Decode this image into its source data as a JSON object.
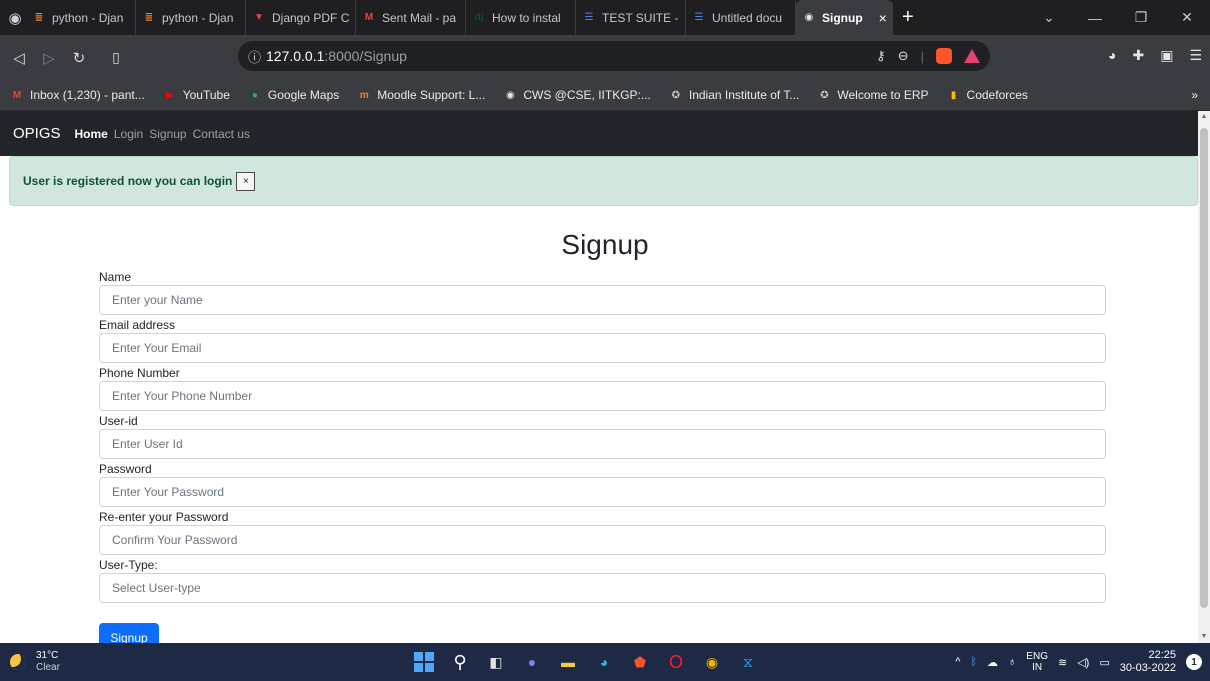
{
  "browser": {
    "tabs": [
      {
        "title": "python - Djan",
        "icon": "stackoverflow-icon",
        "icon_color": "#f48024"
      },
      {
        "title": "python - Djan",
        "icon": "stackoverflow-icon",
        "icon_color": "#f48024"
      },
      {
        "title": "Django PDF C",
        "icon": "vue-icon",
        "icon_color": "#e0424b"
      },
      {
        "title": "Sent Mail - pa",
        "icon": "gmail-icon",
        "icon_color": "#ea4335"
      },
      {
        "title": "How to instal",
        "icon": "django-icon",
        "icon_color": "#0c4b33"
      },
      {
        "title": "TEST SUITE -",
        "icon": "docs-icon",
        "icon_color": "#4285f4"
      },
      {
        "title": "Untitled docu",
        "icon": "docs-icon",
        "icon_color": "#4285f4"
      }
    ],
    "active_tab": {
      "title": "Signup",
      "close": "×"
    },
    "new_tab": "+",
    "url_host": "127.0.0.1",
    "url_rest": ":8000/Signup",
    "bookmarks": [
      {
        "label": "Inbox (1,230) - pant...",
        "icon": "gmail-icon",
        "icon_color": "#ea4335"
      },
      {
        "label": "YouTube",
        "icon": "youtube-icon",
        "icon_color": "#ff0000"
      },
      {
        "label": "Google Maps",
        "icon": "maps-icon",
        "icon_color": "#34a853"
      },
      {
        "label": "Moodle Support: L...",
        "icon": "moodle-icon",
        "icon_color": "#f98012"
      },
      {
        "label": "CWS @CSE, IITKGP:...",
        "icon": "globe-icon",
        "icon_color": "#e8eaed"
      },
      {
        "label": "Indian Institute of T...",
        "icon": "iit-logo-icon",
        "icon_color": "#c8c8c8"
      },
      {
        "label": "Welcome to ERP",
        "icon": "iit-logo-icon",
        "icon_color": "#c8c8c8"
      },
      {
        "label": "Codeforces",
        "icon": "codeforces-icon",
        "icon_color": "#f5c400"
      }
    ],
    "bookmarks_more": "»"
  },
  "site": {
    "brand": "OPIGS",
    "nav": [
      {
        "label": "Home",
        "active": true
      },
      {
        "label": "Login",
        "active": false
      },
      {
        "label": "Signup",
        "active": false
      },
      {
        "label": "Contact us",
        "active": false
      }
    ],
    "alert": "User is registered now you can login",
    "alert_close": "×"
  },
  "form": {
    "title": "Signup",
    "fields": [
      {
        "label": "Name",
        "placeholder": "Enter your Name"
      },
      {
        "label": "Email address",
        "placeholder": "Enter Your Email"
      },
      {
        "label": "Phone Number",
        "placeholder": "Enter Your Phone Number"
      },
      {
        "label": "User-id",
        "placeholder": "Enter User Id"
      },
      {
        "label": "Password",
        "placeholder": "Enter Your Password"
      },
      {
        "label": "Re-enter your Password",
        "placeholder": "Confirm Your Password"
      },
      {
        "label": "User-Type:",
        "placeholder": "Select User-type"
      }
    ],
    "submit": "Signup"
  },
  "taskbar": {
    "temperature": "31°C",
    "condition": "Clear",
    "lang_top": "ENG",
    "lang_bottom": "IN",
    "time": "22:25",
    "date": "30-03-2022",
    "notifications": "1"
  },
  "colors": {
    "primary_button": "#0d6efd",
    "alert_bg": "#d1e7dd",
    "alert_text": "#0f5132",
    "site_nav_bg": "#212529"
  }
}
